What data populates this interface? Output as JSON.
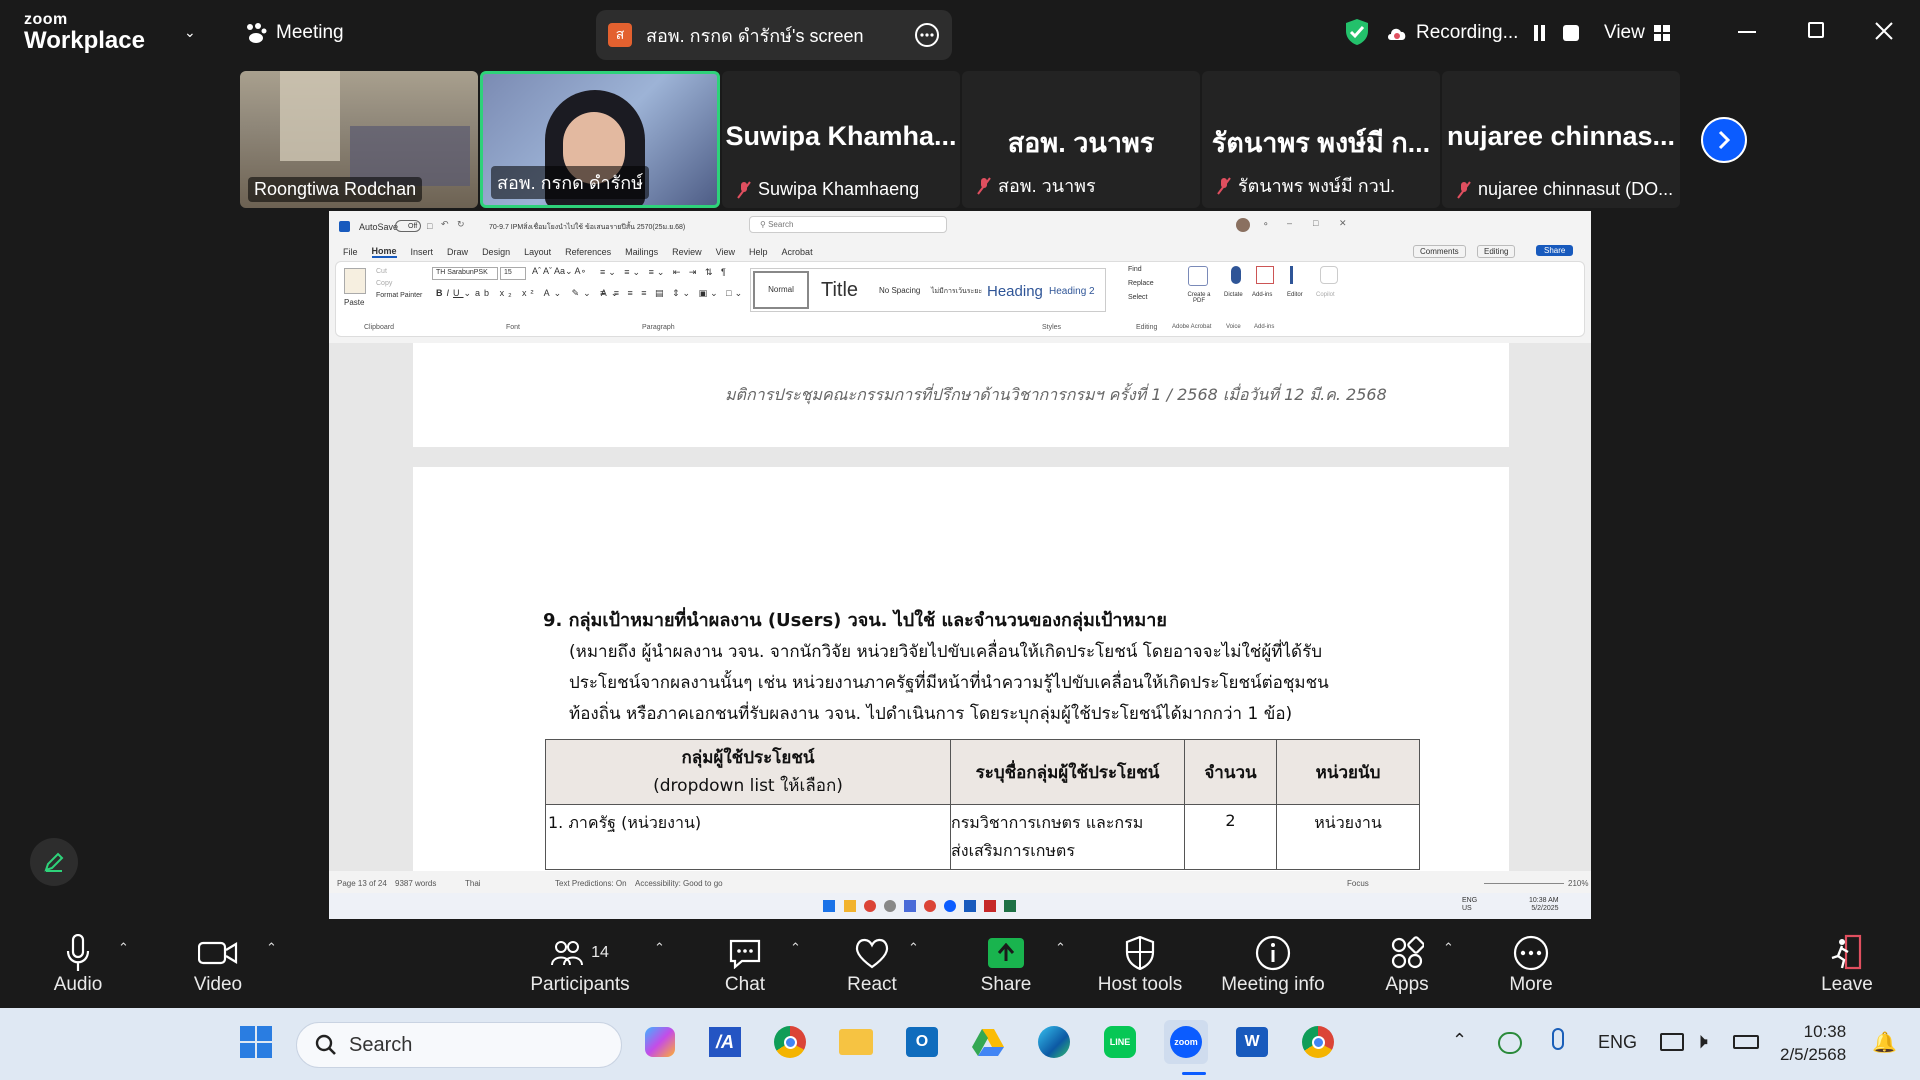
{
  "zoom": {
    "brand_top": "zoom",
    "brand_bottom": "Workplace",
    "meeting_label": "Meeting",
    "share_title": "สอพ. กรกด ดำรักษ์'s screen",
    "share_avatar": "ส",
    "recording_label": "Recording...",
    "view_label": "View"
  },
  "participants_strip": [
    {
      "label": "Roongtiwa Rodchan",
      "video": true
    },
    {
      "label": "สอพ. กรกด ดำรักษ์",
      "video": true,
      "active": true
    },
    {
      "big": "Suwipa  Khamha...",
      "label": "Suwipa Khamhaeng"
    },
    {
      "big": "สอพ. วนาพร",
      "label": "สอพ. วนาพร"
    },
    {
      "big": "รัตนาพร พงษ์มี ก...",
      "label": "รัตนาพร พงษ์มี กวป."
    },
    {
      "big": "nujaree  chinnas...",
      "label": "nujaree chinnasut (DO..."
    }
  ],
  "word": {
    "autosave": "AutoSave",
    "autosave_state": "Off",
    "filename": "70-9.7 IPMสิ่งเชื่อมโยงนำไปใช้ ข้อเสนอรายปีสั้น 2570(25ม.ย.68)",
    "search_placeholder": "Search",
    "menus": [
      "File",
      "Home",
      "Insert",
      "Draw",
      "Design",
      "Layout",
      "References",
      "Mailings",
      "Review",
      "View",
      "Help",
      "Acrobat"
    ],
    "comments": "Comments",
    "editing": "Editing",
    "share": "Share",
    "font_name": "TH SarabunPSK",
    "font_size": "15",
    "clipboard": {
      "paste": "Paste",
      "cut": "Cut",
      "copy": "Copy",
      "format_painter": "Format Painter",
      "group": "Clipboard"
    },
    "groups": {
      "font": "Font",
      "paragraph": "Paragraph",
      "styles": "Styles",
      "editing": "Editing",
      "adobe": "Adobe Acrobat",
      "voice": "Voice",
      "addins": "Add-ins"
    },
    "styles": [
      "Normal",
      "Title",
      "No Spacing",
      "ไม่มีการเว้นระยะ",
      "Heading",
      "Heading 2"
    ],
    "editing_items": [
      "Find",
      "Replace",
      "Select"
    ],
    "right_buttons": [
      "Create a PDF",
      "Dictate",
      "Add-ins",
      "Editor",
      "Copilot"
    ],
    "page_header": "มติการประชุมคณะกรรมการที่ปรึกษาด้านวิชาการกรมฯ ครั้งที่ 1 / 2568 เมื่อวันที่ 12 มี.ค. 2568",
    "heading": "9. กลุ่มเป้าหมายที่นำผลงาน (Users) วจน. ไปใช้ และจำนวนของกลุ่มเป้าหมาย",
    "paragraph": [
      "(หมายถึง ผู้นำผลงาน วจน. จากนักวิจัย หน่วยวิจัยไปขับเคลื่อนให้เกิดประโยชน์ โดยอาจจะไม่ใช่ผู้ที่ได้รับ",
      "ประโยชน์จากผลงานนั้นๆ เช่น หน่วยงานภาครัฐที่มีหน้าที่นำความรู้ไปขับเคลื่อนให้เกิดประโยชน์ต่อชุมชน",
      "ท้องถิ่น หรือภาคเอกชนที่รับผลงาน วจน. ไปดำเนินการ โดยระบุกลุ่มผู้ใช้ประโยชน์ได้มากกว่า 1 ข้อ)"
    ],
    "table": {
      "headers": [
        "กลุ่มผู้ใช้ประโยชน์",
        "(dropdown list ให้เลือก)",
        "ระบุชื่อกลุ่มผู้ใช้ประโยชน์",
        "จำนวน",
        "หน่วยนับ"
      ],
      "row1": [
        "1. ภาครัฐ (หน่วยงาน)",
        "กรมวิชาการเกษตร และกรม",
        "ส่งเสริมการเกษตร",
        "2",
        "หน่วยงาน"
      ]
    },
    "status": {
      "page": "Page 13 of 24",
      "words": "9387 words",
      "lang": "Thai",
      "predictions": "Text Predictions: On",
      "accessibility": "Accessibility: Good to go",
      "focus": "Focus",
      "zoom": "210%"
    },
    "inner_tray": {
      "lang": "ENG",
      "lang2": "US",
      "time": "10:38 AM",
      "date": "5/2/2025"
    }
  },
  "toolbar": {
    "audio": "Audio",
    "video": "Video",
    "participants": "Participants",
    "participants_count": "14",
    "chat": "Chat",
    "react": "React",
    "share": "Share",
    "host_tools": "Host tools",
    "meeting_info": "Meeting info",
    "apps": "Apps",
    "more": "More",
    "leave": "Leave"
  },
  "taskbar": {
    "search_placeholder": "Search",
    "lang": "ENG",
    "time": "10:38",
    "date": "2/5/2568"
  },
  "colors": {
    "accent": "#0b5cff",
    "active_border": "#2ed27a",
    "recording": "#e04f5f",
    "share_green": "#19b44e"
  }
}
